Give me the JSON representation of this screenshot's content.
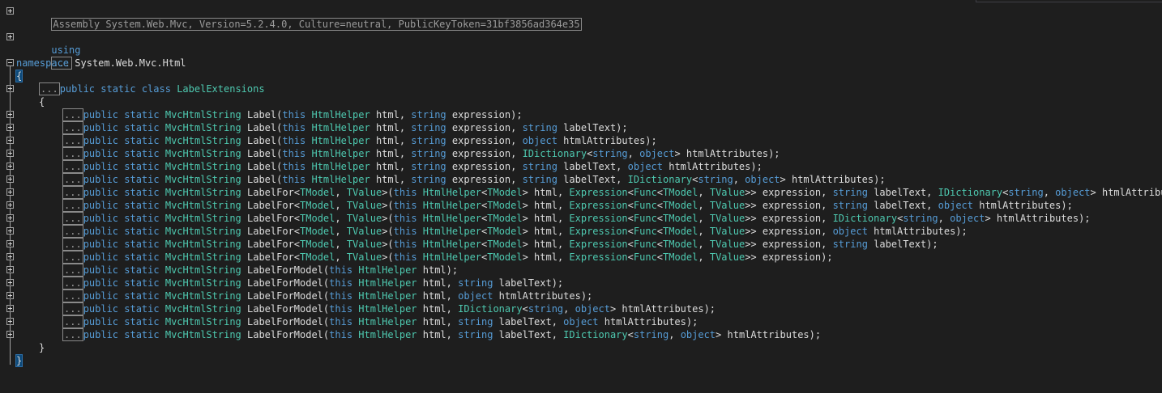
{
  "editor": {
    "assembly": "Assembly System.Web.Mvc, Version=5.2.4.0, Culture=neutral, PublicKeyToken=31bf3856ad364e35",
    "using_kw": "using",
    "collapsed": "...",
    "namespace_kw": "namespace",
    "namespace_name": "System.Web.Mvc.Html",
    "open_brace": "{",
    "close_brace": "}",
    "class_mods": "public static class",
    "class_name": "LabelExtensions",
    "methods": [
      [
        [
          "kw",
          "public static "
        ],
        [
          "ty",
          "MvcHtmlString"
        ],
        [
          "t",
          " Label("
        ],
        [
          "kw",
          "this "
        ],
        [
          "ty",
          "HtmlHelper"
        ],
        [
          "t",
          " html, "
        ],
        [
          "kw",
          "string"
        ],
        [
          "t",
          " expression);"
        ]
      ],
      [
        [
          "kw",
          "public static "
        ],
        [
          "ty",
          "MvcHtmlString"
        ],
        [
          "t",
          " Label("
        ],
        [
          "kw",
          "this "
        ],
        [
          "ty",
          "HtmlHelper"
        ],
        [
          "t",
          " html, "
        ],
        [
          "kw",
          "string"
        ],
        [
          "t",
          " expression, "
        ],
        [
          "kw",
          "string"
        ],
        [
          "t",
          " labelText);"
        ]
      ],
      [
        [
          "kw",
          "public static "
        ],
        [
          "ty",
          "MvcHtmlString"
        ],
        [
          "t",
          " Label("
        ],
        [
          "kw",
          "this "
        ],
        [
          "ty",
          "HtmlHelper"
        ],
        [
          "t",
          " html, "
        ],
        [
          "kw",
          "string"
        ],
        [
          "t",
          " expression, "
        ],
        [
          "kw",
          "object"
        ],
        [
          "t",
          " htmlAttributes);"
        ]
      ],
      [
        [
          "kw",
          "public static "
        ],
        [
          "ty",
          "MvcHtmlString"
        ],
        [
          "t",
          " Label("
        ],
        [
          "kw",
          "this "
        ],
        [
          "ty",
          "HtmlHelper"
        ],
        [
          "t",
          " html, "
        ],
        [
          "kw",
          "string"
        ],
        [
          "t",
          " expression, "
        ],
        [
          "ty",
          "IDictionary"
        ],
        [
          "t",
          "<"
        ],
        [
          "kw",
          "string"
        ],
        [
          "t",
          ", "
        ],
        [
          "kw",
          "object"
        ],
        [
          "t",
          "> htmlAttributes);"
        ]
      ],
      [
        [
          "kw",
          "public static "
        ],
        [
          "ty",
          "MvcHtmlString"
        ],
        [
          "t",
          " Label("
        ],
        [
          "kw",
          "this "
        ],
        [
          "ty",
          "HtmlHelper"
        ],
        [
          "t",
          " html, "
        ],
        [
          "kw",
          "string"
        ],
        [
          "t",
          " expression, "
        ],
        [
          "kw",
          "string"
        ],
        [
          "t",
          " labelText, "
        ],
        [
          "kw",
          "object"
        ],
        [
          "t",
          " htmlAttributes);"
        ]
      ],
      [
        [
          "kw",
          "public static "
        ],
        [
          "ty",
          "MvcHtmlString"
        ],
        [
          "t",
          " Label("
        ],
        [
          "kw",
          "this "
        ],
        [
          "ty",
          "HtmlHelper"
        ],
        [
          "t",
          " html, "
        ],
        [
          "kw",
          "string"
        ],
        [
          "t",
          " expression, "
        ],
        [
          "kw",
          "string"
        ],
        [
          "t",
          " labelText, "
        ],
        [
          "ty",
          "IDictionary"
        ],
        [
          "t",
          "<"
        ],
        [
          "kw",
          "string"
        ],
        [
          "t",
          ", "
        ],
        [
          "kw",
          "object"
        ],
        [
          "t",
          "> htmlAttributes);"
        ]
      ],
      [
        [
          "kw",
          "public static "
        ],
        [
          "ty",
          "MvcHtmlString"
        ],
        [
          "t",
          " LabelFor<"
        ],
        [
          "ty",
          "TModel"
        ],
        [
          "t",
          ", "
        ],
        [
          "ty",
          "TValue"
        ],
        [
          "t",
          ">("
        ],
        [
          "kw",
          "this "
        ],
        [
          "ty",
          "HtmlHelper"
        ],
        [
          "t",
          "<"
        ],
        [
          "ty",
          "TModel"
        ],
        [
          "t",
          "> html, "
        ],
        [
          "ty",
          "Expression"
        ],
        [
          "t",
          "<"
        ],
        [
          "ty",
          "Func"
        ],
        [
          "t",
          "<"
        ],
        [
          "ty",
          "TModel"
        ],
        [
          "t",
          ", "
        ],
        [
          "ty",
          "TValue"
        ],
        [
          "t",
          ">> expression, "
        ],
        [
          "kw",
          "string"
        ],
        [
          "t",
          " labelText, "
        ],
        [
          "ty",
          "IDictionary"
        ],
        [
          "t",
          "<"
        ],
        [
          "kw",
          "string"
        ],
        [
          "t",
          ", "
        ],
        [
          "kw",
          "object"
        ],
        [
          "t",
          "> htmlAttributes);"
        ]
      ],
      [
        [
          "kw",
          "public static "
        ],
        [
          "ty",
          "MvcHtmlString"
        ],
        [
          "t",
          " LabelFor<"
        ],
        [
          "ty",
          "TModel"
        ],
        [
          "t",
          ", "
        ],
        [
          "ty",
          "TValue"
        ],
        [
          "t",
          ">("
        ],
        [
          "kw",
          "this "
        ],
        [
          "ty",
          "HtmlHelper"
        ],
        [
          "t",
          "<"
        ],
        [
          "ty",
          "TModel"
        ],
        [
          "t",
          "> html, "
        ],
        [
          "ty",
          "Expression"
        ],
        [
          "t",
          "<"
        ],
        [
          "ty",
          "Func"
        ],
        [
          "t",
          "<"
        ],
        [
          "ty",
          "TModel"
        ],
        [
          "t",
          ", "
        ],
        [
          "ty",
          "TValue"
        ],
        [
          "t",
          ">> expression, "
        ],
        [
          "kw",
          "string"
        ],
        [
          "t",
          " labelText, "
        ],
        [
          "kw",
          "object"
        ],
        [
          "t",
          " htmlAttributes);"
        ]
      ],
      [
        [
          "kw",
          "public static "
        ],
        [
          "ty",
          "MvcHtmlString"
        ],
        [
          "t",
          " LabelFor<"
        ],
        [
          "ty",
          "TModel"
        ],
        [
          "t",
          ", "
        ],
        [
          "ty",
          "TValue"
        ],
        [
          "t",
          ">("
        ],
        [
          "kw",
          "this "
        ],
        [
          "ty",
          "HtmlHelper"
        ],
        [
          "t",
          "<"
        ],
        [
          "ty",
          "TModel"
        ],
        [
          "t",
          "> html, "
        ],
        [
          "ty",
          "Expression"
        ],
        [
          "t",
          "<"
        ],
        [
          "ty",
          "Func"
        ],
        [
          "t",
          "<"
        ],
        [
          "ty",
          "TModel"
        ],
        [
          "t",
          ", "
        ],
        [
          "ty",
          "TValue"
        ],
        [
          "t",
          ">> expression, "
        ],
        [
          "ty",
          "IDictionary"
        ],
        [
          "t",
          "<"
        ],
        [
          "kw",
          "string"
        ],
        [
          "t",
          ", "
        ],
        [
          "kw",
          "object"
        ],
        [
          "t",
          "> htmlAttributes);"
        ]
      ],
      [
        [
          "kw",
          "public static "
        ],
        [
          "ty",
          "MvcHtmlString"
        ],
        [
          "t",
          " LabelFor<"
        ],
        [
          "ty",
          "TModel"
        ],
        [
          "t",
          ", "
        ],
        [
          "ty",
          "TValue"
        ],
        [
          "t",
          ">("
        ],
        [
          "kw",
          "this "
        ],
        [
          "ty",
          "HtmlHelper"
        ],
        [
          "t",
          "<"
        ],
        [
          "ty",
          "TModel"
        ],
        [
          "t",
          "> html, "
        ],
        [
          "ty",
          "Expression"
        ],
        [
          "t",
          "<"
        ],
        [
          "ty",
          "Func"
        ],
        [
          "t",
          "<"
        ],
        [
          "ty",
          "TModel"
        ],
        [
          "t",
          ", "
        ],
        [
          "ty",
          "TValue"
        ],
        [
          "t",
          ">> expression, "
        ],
        [
          "kw",
          "object"
        ],
        [
          "t",
          " htmlAttributes);"
        ]
      ],
      [
        [
          "kw",
          "public static "
        ],
        [
          "ty",
          "MvcHtmlString"
        ],
        [
          "t",
          " LabelFor<"
        ],
        [
          "ty",
          "TModel"
        ],
        [
          "t",
          ", "
        ],
        [
          "ty",
          "TValue"
        ],
        [
          "t",
          ">("
        ],
        [
          "kw",
          "this "
        ],
        [
          "ty",
          "HtmlHelper"
        ],
        [
          "t",
          "<"
        ],
        [
          "ty",
          "TModel"
        ],
        [
          "t",
          "> html, "
        ],
        [
          "ty",
          "Expression"
        ],
        [
          "t",
          "<"
        ],
        [
          "ty",
          "Func"
        ],
        [
          "t",
          "<"
        ],
        [
          "ty",
          "TModel"
        ],
        [
          "t",
          ", "
        ],
        [
          "ty",
          "TValue"
        ],
        [
          "t",
          ">> expression, "
        ],
        [
          "kw",
          "string"
        ],
        [
          "t",
          " labelText);"
        ]
      ],
      [
        [
          "kw",
          "public static "
        ],
        [
          "ty",
          "MvcHtmlString"
        ],
        [
          "t",
          " LabelFor<"
        ],
        [
          "ty",
          "TModel"
        ],
        [
          "t",
          ", "
        ],
        [
          "ty",
          "TValue"
        ],
        [
          "t",
          ">("
        ],
        [
          "kw",
          "this "
        ],
        [
          "ty",
          "HtmlHelper"
        ],
        [
          "t",
          "<"
        ],
        [
          "ty",
          "TModel"
        ],
        [
          "t",
          "> html, "
        ],
        [
          "ty",
          "Expression"
        ],
        [
          "t",
          "<"
        ],
        [
          "ty",
          "Func"
        ],
        [
          "t",
          "<"
        ],
        [
          "ty",
          "TModel"
        ],
        [
          "t",
          ", "
        ],
        [
          "ty",
          "TValue"
        ],
        [
          "t",
          ">> expression);"
        ]
      ],
      [
        [
          "kw",
          "public static "
        ],
        [
          "ty",
          "MvcHtmlString"
        ],
        [
          "t",
          " LabelForModel("
        ],
        [
          "kw",
          "this "
        ],
        [
          "ty",
          "HtmlHelper"
        ],
        [
          "t",
          " html);"
        ]
      ],
      [
        [
          "kw",
          "public static "
        ],
        [
          "ty",
          "MvcHtmlString"
        ],
        [
          "t",
          " LabelForModel("
        ],
        [
          "kw",
          "this "
        ],
        [
          "ty",
          "HtmlHelper"
        ],
        [
          "t",
          " html, "
        ],
        [
          "kw",
          "string"
        ],
        [
          "t",
          " labelText);"
        ]
      ],
      [
        [
          "kw",
          "public static "
        ],
        [
          "ty",
          "MvcHtmlString"
        ],
        [
          "t",
          " LabelForModel("
        ],
        [
          "kw",
          "this "
        ],
        [
          "ty",
          "HtmlHelper"
        ],
        [
          "t",
          " html, "
        ],
        [
          "kw",
          "object"
        ],
        [
          "t",
          " htmlAttributes);"
        ]
      ],
      [
        [
          "kw",
          "public static "
        ],
        [
          "ty",
          "MvcHtmlString"
        ],
        [
          "t",
          " LabelForModel("
        ],
        [
          "kw",
          "this "
        ],
        [
          "ty",
          "HtmlHelper"
        ],
        [
          "t",
          " html, "
        ],
        [
          "ty",
          "IDictionary"
        ],
        [
          "t",
          "<"
        ],
        [
          "kw",
          "string"
        ],
        [
          "t",
          ", "
        ],
        [
          "kw",
          "object"
        ],
        [
          "t",
          "> htmlAttributes);"
        ]
      ],
      [
        [
          "kw",
          "public static "
        ],
        [
          "ty",
          "MvcHtmlString"
        ],
        [
          "t",
          " LabelForModel("
        ],
        [
          "kw",
          "this "
        ],
        [
          "ty",
          "HtmlHelper"
        ],
        [
          "t",
          " html, "
        ],
        [
          "kw",
          "string"
        ],
        [
          "t",
          " labelText, "
        ],
        [
          "kw",
          "object"
        ],
        [
          "t",
          " htmlAttributes);"
        ]
      ],
      [
        [
          "kw",
          "public static "
        ],
        [
          "ty",
          "MvcHtmlString"
        ],
        [
          "t",
          " LabelForModel("
        ],
        [
          "kw",
          "this "
        ],
        [
          "ty",
          "HtmlHelper"
        ],
        [
          "t",
          " html, "
        ],
        [
          "kw",
          "string"
        ],
        [
          "t",
          " labelText, "
        ],
        [
          "ty",
          "IDictionary"
        ],
        [
          "t",
          "<"
        ],
        [
          "kw",
          "string"
        ],
        [
          "t",
          ", "
        ],
        [
          "kw",
          "object"
        ],
        [
          "t",
          "> htmlAttributes);"
        ]
      ]
    ]
  },
  "colors": {
    "background": "#1e1e1e",
    "keyword": "#569cd6",
    "type": "#4ec9b0",
    "text": "#dcdcdc",
    "metadata": "#9b9b9b"
  }
}
